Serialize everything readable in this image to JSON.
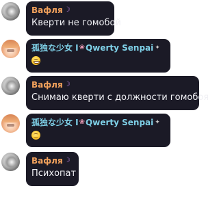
{
  "messages": [
    {
      "author": "Вафля",
      "author_color": "#f3a25c",
      "author_deco": "☽",
      "avatar": "dark-avatar",
      "text": "Кверти не гомобой"
    },
    {
      "author": "孤独な少女 I",
      "author_mid": "Qwerty Senpai",
      "author_color": "#7fd1e8",
      "author_deco": "❀",
      "author_deco_end": "✦",
      "avatar": "anime-girl-avatar",
      "emoji": "grinning-face-icon"
    },
    {
      "author": "Вафля",
      "author_color": "#f3a25c",
      "author_deco": "☽",
      "avatar": "dark-avatar",
      "text": "Снимаю кверти с должности гомобоя"
    },
    {
      "author": "孤独な少女 I",
      "author_mid": "Qwerty Senpai",
      "author_color": "#7fd1e8",
      "author_deco": "❀",
      "author_deco_end": "✦",
      "avatar": "anime-girl-avatar",
      "emoji": "smiling-face-icon"
    },
    {
      "author": "Вафля",
      "author_color": "#f3a25c",
      "author_deco": "☽",
      "avatar": "dark-avatar",
      "text": "Психопат"
    }
  ]
}
